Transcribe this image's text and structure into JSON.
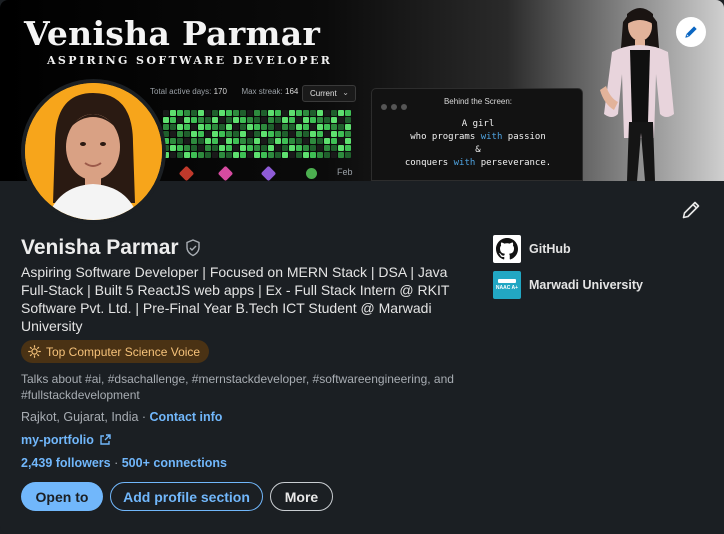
{
  "banner": {
    "name": "Venisha Parmar",
    "subtitle": "ASPIRING SOFTWARE DEVELOPER",
    "stats": {
      "active_days_label": "Total active days:",
      "active_days_value": "170",
      "max_streak_label": "Max streak:",
      "max_streak_value": "164",
      "period_select": "Current",
      "month_label": "Feb"
    },
    "terminal": {
      "title": "Behind the Screen:",
      "line1": "A girl",
      "line2_pre": "who programs ",
      "line2_kw": "with",
      "line2_post": " passion",
      "line3": "&",
      "line4_pre": "conquers ",
      "line4_kw": "with",
      "line4_post": " perseverance."
    }
  },
  "profile": {
    "name": "Venisha Parmar",
    "headline": "Aspiring Software Developer | Focused on MERN Stack | DSA | Java Full-Stack | Built 5 ReactJS web apps | Ex - Full Stack Intern @ RKIT Software Pvt. Ltd. | Pre-Final Year B.Tech ICT Student @ Marwadi University",
    "voice_badge": "Top Computer Science Voice",
    "talks_about": "Talks about #ai, #dsachallenge, #mernstackdeveloper, #softwareengineering, and #fullstackdevelopment",
    "location": "Rajkot, Gujarat, India",
    "location_sep": " · ",
    "contact_info": "Contact info",
    "portfolio_link": "my-portfolio",
    "followers": "2,439 followers",
    "network_sep": " · ",
    "connections": "500+ connections"
  },
  "actions": {
    "open_to": "Open to",
    "add_section": "Add profile section",
    "more": "More"
  },
  "side_links": {
    "github": "GitHub",
    "university": "Marwadi University",
    "university_logo_text": "NAAC A+"
  },
  "colors": {
    "background": "#1b1f23",
    "link": "#71b7fb",
    "badge_bg": "#4a3214",
    "badge_text": "#f5c27a",
    "avatar_bg": "#f7a51b"
  },
  "icons": {
    "edit_banner": "pencil-icon",
    "edit_intro": "pencil-icon",
    "verified": "shield-check-icon",
    "voice_badge": "sun-icon",
    "portfolio": "external-link-icon",
    "github": "github-logo",
    "university": "university-logo"
  }
}
